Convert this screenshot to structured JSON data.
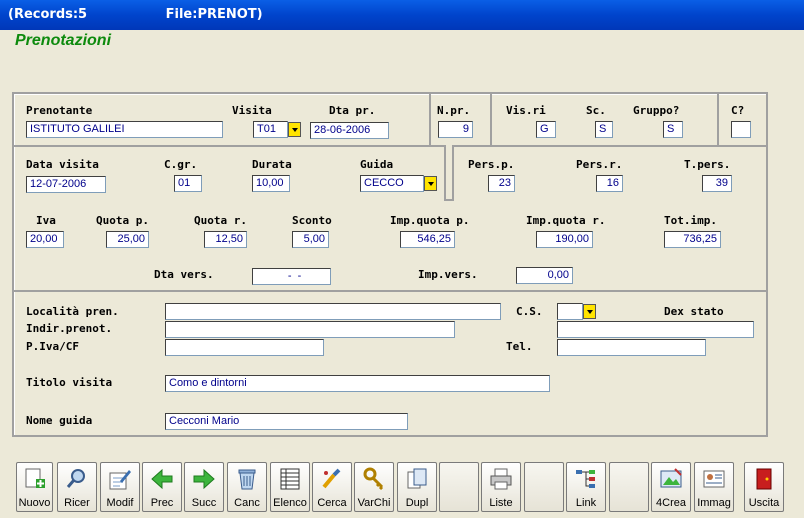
{
  "window": {
    "records": "(Records:5",
    "file": "File:PRENOT)"
  },
  "app_title": "Prenotazioni",
  "labels": {
    "prenotante": "Prenotante",
    "visita": "Visita",
    "dta_pr": "Dta pr.",
    "n_pr": "N.pr.",
    "vis_ri": "Vis.ri",
    "sc": "Sc.",
    "gruppo": "Gruppo?",
    "c": "C?",
    "data_visita": "Data visita",
    "c_gr": "C.gr.",
    "durata": "Durata",
    "guida": "Guida",
    "pers_p": "Pers.p.",
    "pers_r": "Pers.r.",
    "t_pers": "T.pers.",
    "iva": "Iva",
    "quota_p": "Quota p.",
    "quota_r": "Quota r.",
    "sconto": "Sconto",
    "imp_quota_p": "Imp.quota p.",
    "imp_quota_r": "Imp.quota r.",
    "tot_imp": "Tot.imp.",
    "dta_vers": "Dta vers.",
    "imp_vers": "Imp.vers.",
    "localita": "Località pren.",
    "cs": "C.S.",
    "dex_stato": "Dex stato",
    "indir": "Indir.prenot.",
    "piva": "P.Iva/CF",
    "tel": "Tel.",
    "titolo_visita": "Titolo visita",
    "nome_guida": "Nome guida"
  },
  "values": {
    "prenotante": "ISTITUTO GALILEI",
    "visita": "T01",
    "dta_pr": "28-06-2006",
    "n_pr": "9",
    "vis_ri": "G",
    "sc": "S",
    "gruppo": "S",
    "c": "",
    "data_visita": "12-07-2006",
    "c_gr": "01",
    "durata": "10,00",
    "guida": "CECCO",
    "pers_p": "23",
    "pers_r": "16",
    "t_pers": "39",
    "iva": "20,00",
    "quota_p": "25,00",
    "quota_r": "12,50",
    "sconto": "5,00",
    "imp_quota_p": "546,25",
    "imp_quota_r": "190,00",
    "tot_imp": "736,25",
    "dta_vers": "  -  -",
    "imp_vers": "0,00",
    "localita": "",
    "cs": "",
    "dex_stato": "",
    "indir": "",
    "piva": "",
    "tel": "",
    "titolo_visita": "Como e dintorni",
    "nome_guida": "Cecconi Mario"
  },
  "toolbar": [
    {
      "label": "Nuovo",
      "icon": "new-record-icon"
    },
    {
      "label": "Ricer",
      "icon": "search-icon"
    },
    {
      "label": "Modif",
      "icon": "edit-icon"
    },
    {
      "label": "Prec",
      "icon": "arrow-left-icon"
    },
    {
      "label": "Succ",
      "icon": "arrow-right-icon"
    },
    {
      "label": "Canc",
      "icon": "trash-icon"
    },
    {
      "label": "Elenco",
      "icon": "list-icon"
    },
    {
      "label": "Cerca",
      "icon": "find-icon"
    },
    {
      "label": "VarChi",
      "icon": "keys-icon"
    },
    {
      "label": "Dupl",
      "icon": "duplicate-icon"
    },
    {
      "label": "Liste",
      "icon": "printer-icon"
    },
    {
      "label": "Link",
      "icon": "link-icon"
    },
    {
      "label": "4Crea",
      "icon": "create-icon"
    },
    {
      "label": "Immag",
      "icon": "image-icon"
    },
    {
      "label": "Uscita",
      "icon": "exit-door-icon"
    }
  ],
  "colors": {
    "accent_green": "#0D8A0D",
    "field_text": "#00008B",
    "dropdown": "#FFE400"
  }
}
